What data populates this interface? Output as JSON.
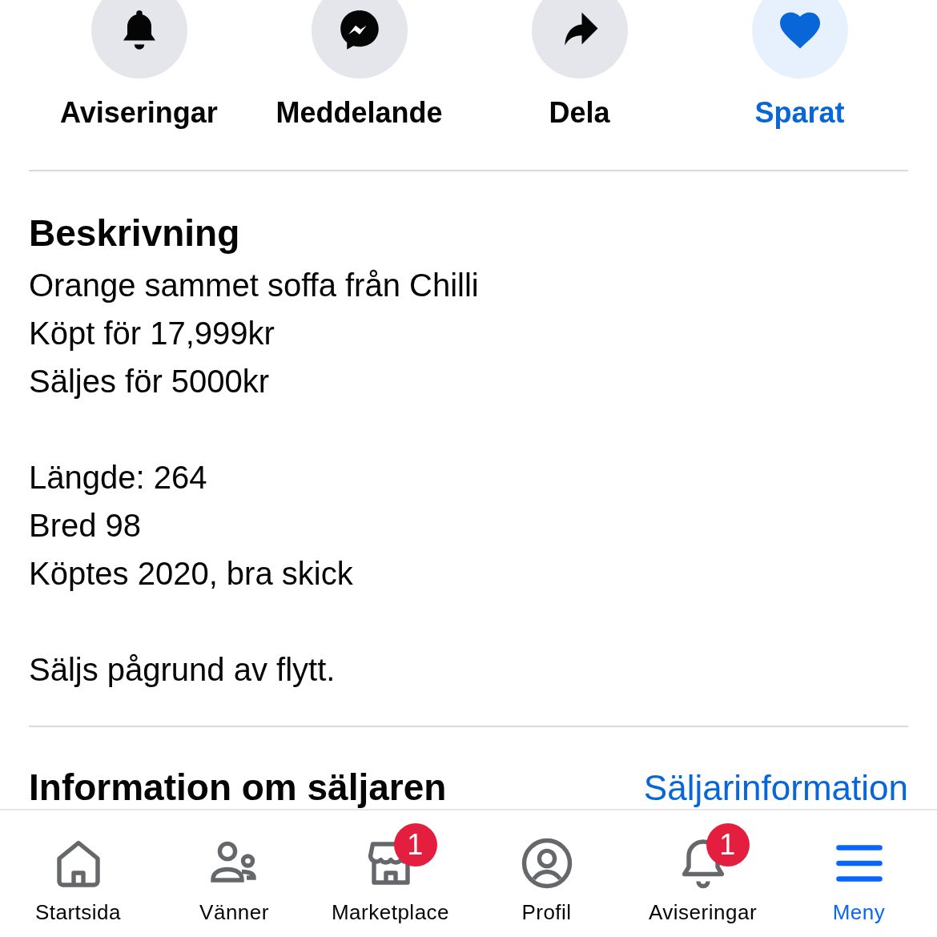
{
  "actions": [
    {
      "label": "Aviseringar",
      "selected": false
    },
    {
      "label": "Meddelande",
      "selected": false
    },
    {
      "label": "Dela",
      "selected": false
    },
    {
      "label": "Sparat",
      "selected": true
    }
  ],
  "description": {
    "title": "Beskrivning",
    "paragraphs": [
      [
        "Orange sammet soffa från Chilli",
        "Köpt för 17,999kr",
        "Säljes för 5000kr"
      ],
      [
        "Längde: 264",
        "Bred 98",
        "Köptes 2020, bra skick"
      ],
      [
        "Säljs pågrund av flytt."
      ]
    ]
  },
  "seller": {
    "title": "Information om säljaren",
    "link": "Säljarinformation"
  },
  "tab_bar": [
    {
      "label": "Startsida",
      "selected": false
    },
    {
      "label": "Vänner",
      "selected": false
    },
    {
      "label": "Marketplace",
      "selected": false,
      "badge": "1"
    },
    {
      "label": "Profil",
      "selected": false
    },
    {
      "label": "Aviseringar",
      "selected": false,
      "badge": "1"
    },
    {
      "label": "Meny",
      "selected": true
    }
  ]
}
